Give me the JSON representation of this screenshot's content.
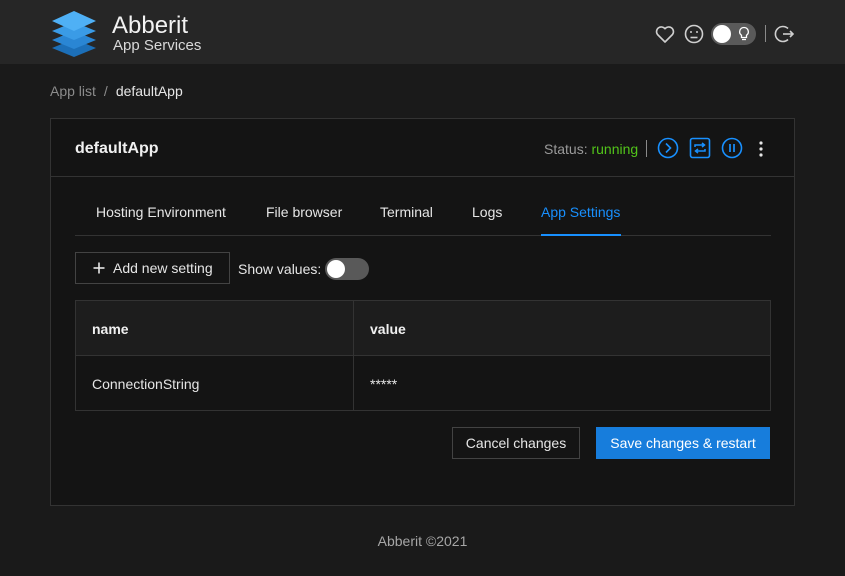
{
  "app": {
    "title": "Abberit",
    "subtitle": "App Services"
  },
  "breadcrumb": {
    "parent": "App list",
    "separator": "/",
    "current": "defaultApp"
  },
  "card": {
    "title": "defaultApp",
    "status_label": "Status:",
    "status_value": "running",
    "actions": [
      "play-icon",
      "restart-icon",
      "pause-icon",
      "more-icon"
    ]
  },
  "tabs": [
    {
      "label": "Hosting Environment"
    },
    {
      "label": "File browser"
    },
    {
      "label": "Terminal"
    },
    {
      "label": "Logs"
    },
    {
      "label": "App Settings",
      "active": true
    }
  ],
  "toolbar": {
    "add_label": "Add new setting",
    "show_values_label": "Show values:",
    "show_values": false
  },
  "table": {
    "columns": [
      "name",
      "value"
    ],
    "rows": [
      {
        "name": "ConnectionString",
        "value": "*****"
      }
    ]
  },
  "buttons": {
    "cancel": "Cancel changes",
    "save": "Save changes & restart"
  },
  "footer": {
    "text": "Abberit ©2021"
  },
  "colors": {
    "accent": "#1890ff",
    "status_running": "#52c41a",
    "primary_button": "#177ddc"
  }
}
